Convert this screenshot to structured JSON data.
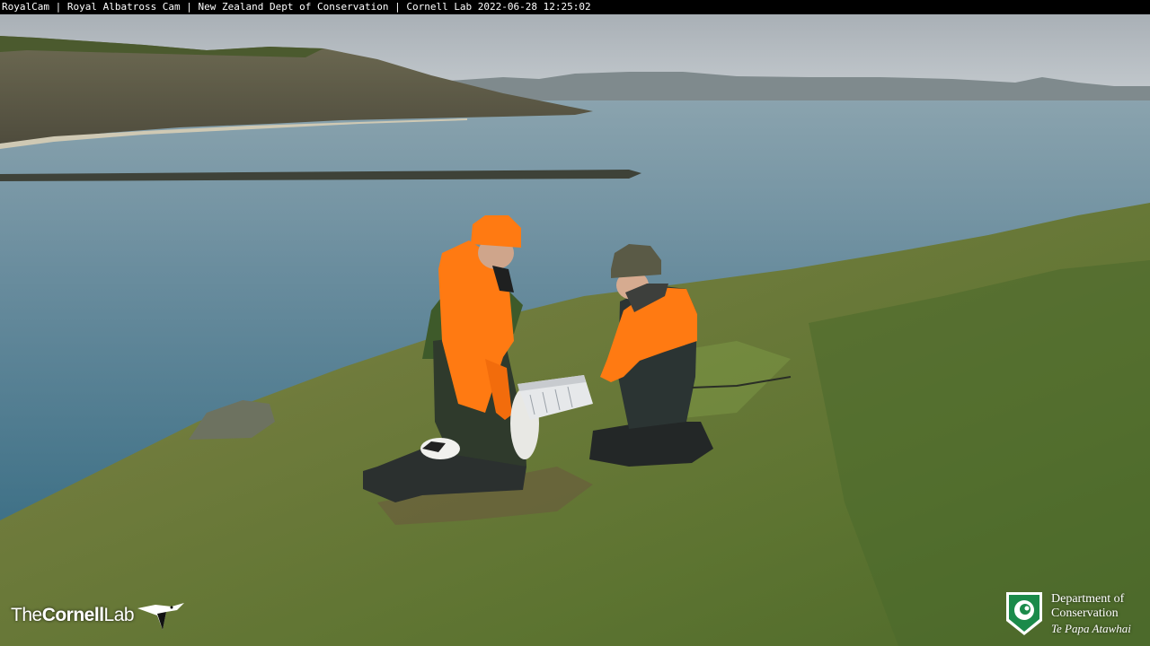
{
  "overlay": {
    "caption": "RoyalCam | Royal Albatross Cam | New Zealand Dept of Conservation | Cornell Lab 2022-06-28 12:25:02"
  },
  "logos": {
    "cornell": {
      "the": "The",
      "cornell": "Cornell",
      "lab": "Lab"
    },
    "doc": {
      "line1": "Department of",
      "line2": "Conservation",
      "line3": "Te Papa Atawhai"
    }
  },
  "colors": {
    "safety_orange": "#ff7a12",
    "sea": "#5e8597",
    "grass": "#6c7a38",
    "doc_green": "#2f8a4a"
  }
}
